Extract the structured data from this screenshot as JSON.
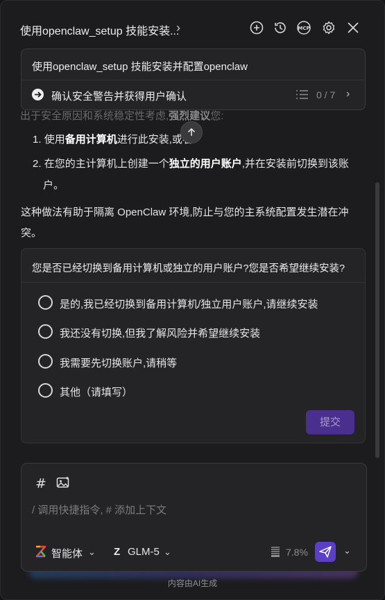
{
  "header": {
    "title": "使用openclaw_setup 技能安装...",
    "icons": [
      "new-chat-icon",
      "history-icon",
      "mcp-icon",
      "settings-icon",
      "close-icon"
    ],
    "mcp_label": "MCP"
  },
  "task": {
    "title": "使用openclaw_setup 技能安装并配置openclaw",
    "current_step": "确认安全警告并获得用户确认",
    "progress": "0 / 7"
  },
  "message": {
    "faded_prefix": "出于安全原因和系统稳定性考虑,",
    "faded_strong": "强烈建议",
    "faded_suffix": "您:",
    "item1_num": "1.",
    "item1_pre": "使用",
    "item1_strong": "备用计算机",
    "item1_post": "进行此安装,或者",
    "item2_num": "2.",
    "item2_pre": "在您的主计算机上创建一个",
    "item2_strong": "独立的用户账户",
    "item2_post": ",并在安装前切换到该账",
    "item2_wrap": "户。",
    "para_line1": "这种做法有助于隔离 OpenClaw 环境,防止与您的主系统配置发生潜在冲",
    "para_line2": "突。"
  },
  "question": {
    "text": "您是否已经切换到备用计算机或独立的用户账户?您是否希望继续安装?",
    "options": [
      "是的,我已经切换到备用计算机/独立用户账户,请继续安装",
      "我还没有切换,但我了解风险并希望继续安装",
      "我需要先切换账户,请稍等",
      "其他（请填写）"
    ],
    "submit_label": "提交"
  },
  "composer": {
    "hash_symbol": "#",
    "placeholder": "/ 调用快捷指令, # 添加上下文",
    "agent_label": "智能体",
    "model_icon": "Z",
    "model_label": "GLM-5",
    "context_usage": "7.8%"
  },
  "footer": {
    "text": "内容由AI生成"
  },
  "colors": {
    "accent": "#5b3fc4",
    "submit_bg": "#4a2f8f",
    "background": "#1c1c1e",
    "card": "#242426"
  }
}
